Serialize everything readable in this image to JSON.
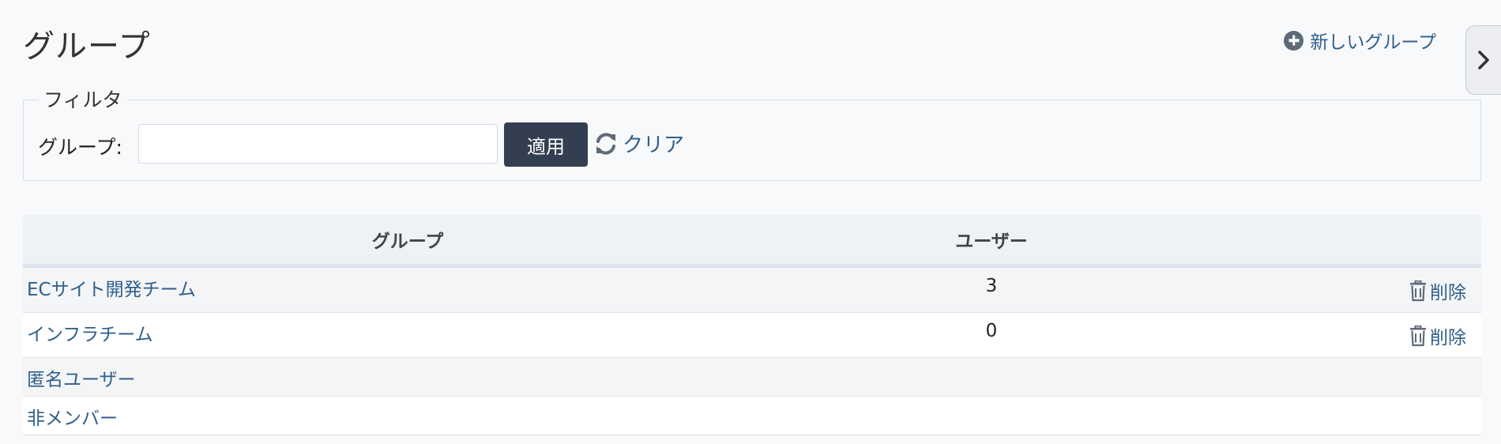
{
  "page": {
    "title": "グループ"
  },
  "header": {
    "new_group_label": "新しいグループ"
  },
  "filter": {
    "legend": "フィルタ",
    "group_label": "グループ:",
    "group_value": "",
    "apply_label": "適用",
    "clear_label": "クリア"
  },
  "table": {
    "headers": {
      "group": "グループ",
      "users": "ユーザー",
      "actions": ""
    },
    "rows": [
      {
        "name": "ECサイト開発チーム",
        "users": "3",
        "action": "削除"
      },
      {
        "name": "インフラチーム",
        "users": "0",
        "action": "削除"
      },
      {
        "name": "匿名ユーザー",
        "users": "",
        "action": ""
      },
      {
        "name": "非メンバー",
        "users": "",
        "action": ""
      }
    ]
  },
  "colors": {
    "accent_link": "#2f5f8a",
    "primary_button": "#333f50",
    "page_background": "#f8f9fb"
  }
}
